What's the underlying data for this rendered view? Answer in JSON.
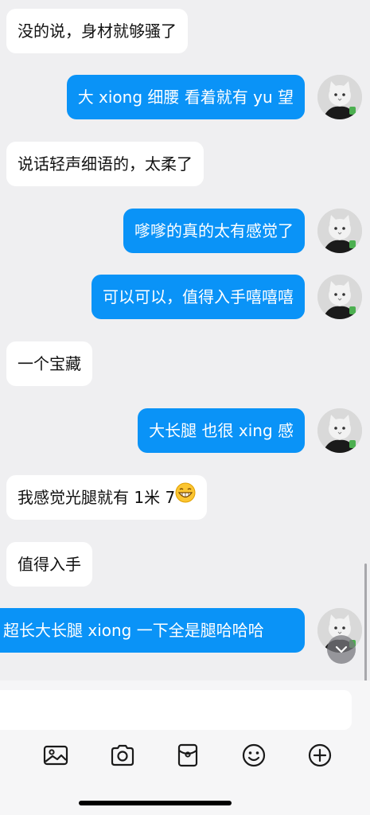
{
  "chat": {
    "messages": [
      {
        "side": "in",
        "text": "没的说，身材就够骚了"
      },
      {
        "side": "out",
        "text": "大 xiong  细腰  看着就有 yu 望"
      },
      {
        "side": "in",
        "text": "说话轻声细语的，太柔了"
      },
      {
        "side": "out",
        "text": "嗲嗲的真的太有感觉了"
      },
      {
        "side": "out",
        "text": "可以可以，值得入手嘻嘻嘻"
      },
      {
        "side": "in",
        "text": "一个宝藏"
      },
      {
        "side": "out",
        "text": "大长腿 也很 xing 感"
      },
      {
        "side": "in",
        "text": "我感觉光腿就有 1米 7",
        "emoji": "grinning-face-emoji"
      },
      {
        "side": "in",
        "text": "值得入手"
      },
      {
        "side": "out",
        "text": "超长大长腿 xiong 一下全是腿哈哈哈"
      }
    ]
  },
  "toolbar": {
    "icons": [
      "image-icon",
      "camera-icon",
      "red-packet-icon",
      "emoji-icon",
      "plus-icon"
    ]
  },
  "colors": {
    "outgoing_bubble": "#0a93f7",
    "incoming_bubble": "#ffffff",
    "background": "#efeff1"
  }
}
